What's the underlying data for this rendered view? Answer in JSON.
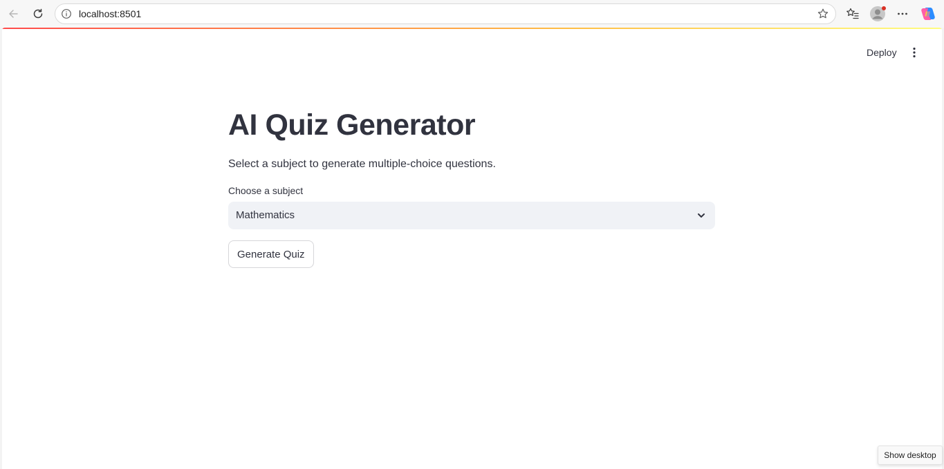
{
  "browser": {
    "url": "localhost:8501",
    "accent_colors": [
      "#ff4b4b",
      "#ffbd45",
      "#fffd80"
    ]
  },
  "icons": {
    "back": "arrow-left-icon",
    "reload": "refresh-icon",
    "site_info": "info-icon",
    "favorite": "star-icon",
    "favorites": "favorites-list-icon",
    "profile": "profile-avatar-icon",
    "more": "ellipsis-icon",
    "copilot": "copilot-icon",
    "app_menu": "vertical-dots-icon",
    "chevron": "chevron-down-icon"
  },
  "header": {
    "deploy_label": "Deploy"
  },
  "main": {
    "title": "AI Quiz Generator",
    "subtitle": "Select a subject to generate multiple-choice questions.",
    "subject_select": {
      "label": "Choose a subject",
      "value": "Mathematics"
    },
    "generate_button_label": "Generate Quiz"
  },
  "tooltip": {
    "text": "Show desktop"
  }
}
